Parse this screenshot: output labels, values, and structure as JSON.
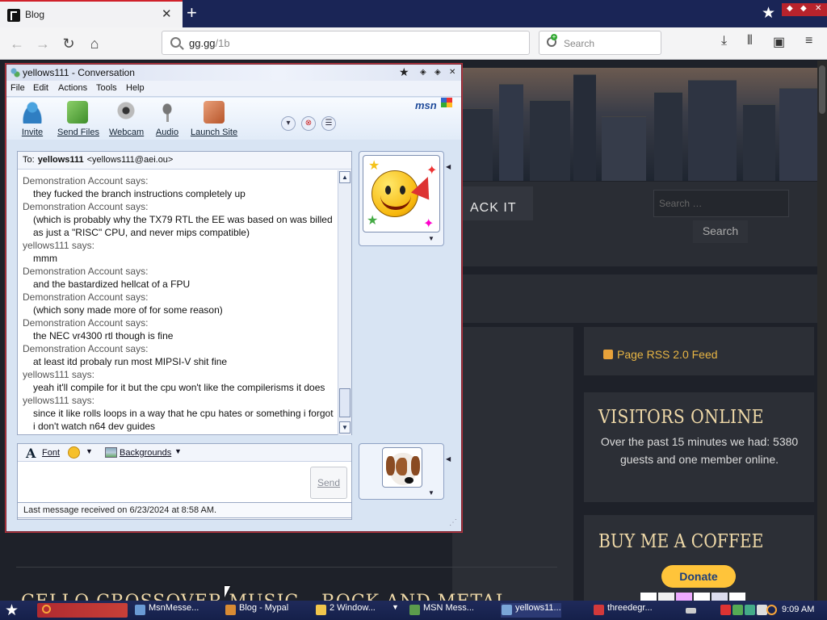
{
  "browser": {
    "tab_title": "Blog",
    "tab_close": "✕",
    "new_tab": "+",
    "url_host": "gg.gg",
    "url_path": "/1b",
    "search_placeholder": "Search",
    "icons": [
      "back-icon",
      "forward-icon",
      "reload-icon",
      "home-icon",
      "download-icon",
      "library-icon",
      "sidebar-icon",
      "menu-icon"
    ]
  },
  "website": {
    "menu_item": "ACK IT",
    "search_placeholder": "Search …",
    "search_button": "Search",
    "rss_link": "Page RSS 2.0 Feed",
    "visitors_title": "VISITORS ONLINE",
    "visitors_text": "Over the past 15 minutes we had: 5380 guests and one member online.",
    "coffee_title": "BUY ME A COFFEE",
    "donate_button": "Donate",
    "bottom_title": "CELLO CROSSOVER MUSIC – ROCK AND METAL"
  },
  "msn": {
    "window_title": "yellows111 - Conversation",
    "menu": [
      "File",
      "Edit",
      "Actions",
      "Tools",
      "Help"
    ],
    "toolbar": [
      "Invite",
      "Send Files",
      "Webcam",
      "Audio",
      "Launch Site"
    ],
    "logo": "msn",
    "to_prefix": "To:",
    "to_name": "yellows111",
    "to_email": "<yellows111@aei.ou>",
    "messages": [
      {
        "sender": "Demonstration Account says:",
        "text": "they fucked the branch instructions completely up"
      },
      {
        "sender": "Demonstration Account says:",
        "text": "(which is probably why the TX79 RTL the EE was based on was billed as just a \"RISC\" CPU, and never mips compatible)"
      },
      {
        "sender": "yellows111 says:",
        "text": "mmm"
      },
      {
        "sender": "Demonstration Account says:",
        "text": "and the bastardized hellcat of a FPU"
      },
      {
        "sender": "Demonstration Account says:",
        "text": "(which sony made more of for some reason)"
      },
      {
        "sender": "Demonstration Account says:",
        "text": "the NEC vr4300 rtl though is fine"
      },
      {
        "sender": "Demonstration Account says:",
        "text": "at least itd probaly run most MIPSI-V shit fine"
      },
      {
        "sender": "yellows111 says:",
        "text": "yeah it'll compile for it but the cpu won't like the compilerisms it does"
      },
      {
        "sender": "yellows111 says:",
        "text": "since it like rolls loops in a way that he cpu hates or something i forgot i don't watch n64 dev guides"
      }
    ],
    "font_label": "Font",
    "backgrounds_label": "Backgrounds",
    "send_label": "Send",
    "status": "Last message received on 6/23/2024 at 8:58 AM."
  },
  "taskbar": {
    "items": [
      "MsnMesse...",
      "Blog - Mypal",
      "2 Window...",
      "MSN Mess...",
      "yellows11...",
      "threedegr..."
    ],
    "clock": "9:09 AM"
  }
}
